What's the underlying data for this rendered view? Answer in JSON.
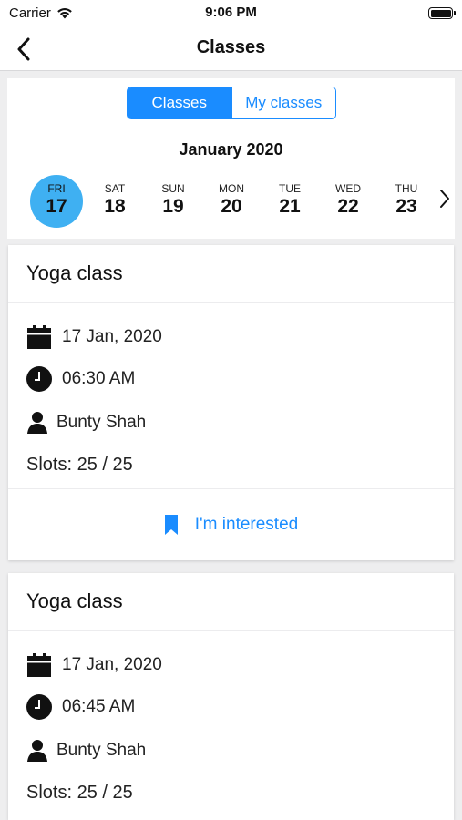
{
  "status_bar": {
    "carrier": "Carrier",
    "time": "9:06 PM"
  },
  "nav": {
    "title": "Classes",
    "back_icon": "chevron-left-icon"
  },
  "segment": {
    "tabs": [
      "Classes",
      "My classes"
    ],
    "active": "Classes"
  },
  "calendar": {
    "month": "January 2020",
    "days": [
      {
        "name": "FRI",
        "num": "17",
        "selected": true
      },
      {
        "name": "SAT",
        "num": "18"
      },
      {
        "name": "SUN",
        "num": "19"
      },
      {
        "name": "MON",
        "num": "20"
      },
      {
        "name": "TUE",
        "num": "21"
      },
      {
        "name": "WED",
        "num": "22"
      },
      {
        "name": "THU",
        "num": "23"
      }
    ],
    "selected_color": "#3fb0f2"
  },
  "classes": [
    {
      "title": "Yoga class",
      "date": "17 Jan, 2020",
      "time": "06:30 AM",
      "instructor": "Bunty Shah",
      "slots": "Slots: 25 / 25",
      "action": "I'm interested"
    },
    {
      "title": "Yoga class",
      "date": "17 Jan, 2020",
      "time": "06:45 AM",
      "instructor": "Bunty Shah",
      "slots": "Slots: 25 / 25"
    }
  ],
  "colors": {
    "accent": "#1a8cff",
    "background": "#eeeeef"
  }
}
